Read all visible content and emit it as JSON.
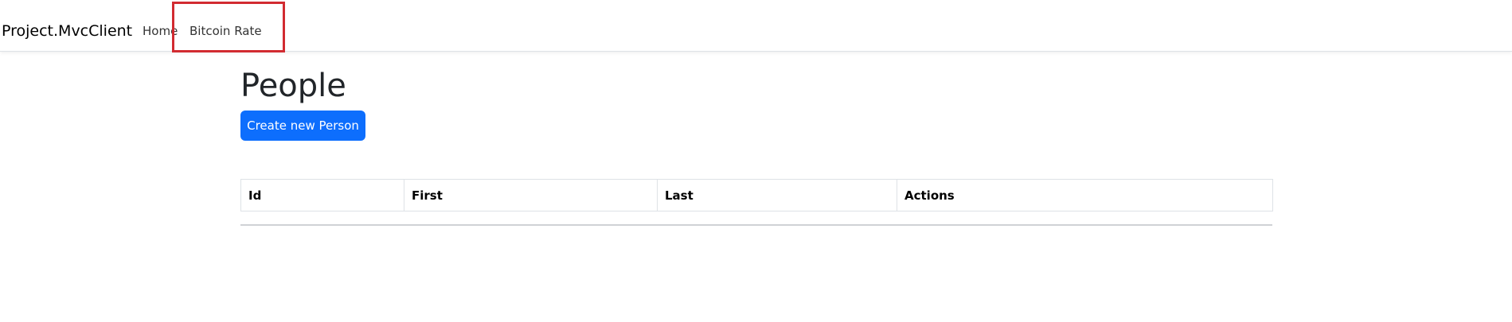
{
  "navbar": {
    "brand": "Project.MvcClient",
    "links": [
      {
        "label": "Home"
      },
      {
        "label": "Bitcoin Rate"
      }
    ],
    "highlight_color": "#d22b31"
  },
  "main": {
    "title": "People",
    "create_button_label": "Create new Person",
    "table": {
      "columns": [
        "Id",
        "First",
        "Last",
        "Actions"
      ],
      "rows": []
    }
  },
  "colors": {
    "primary": "#0d6efd",
    "border": "#dee2e6"
  }
}
